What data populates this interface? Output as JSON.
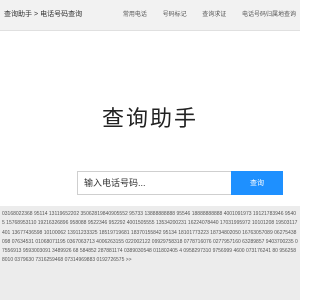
{
  "header": {
    "breadcrumb": [
      "查询助手",
      "电话号码查询"
    ],
    "breadcrumb_sep": ">",
    "nav": [
      "常用电话",
      "号码标记",
      "查询求证",
      "电话号码归属地查询"
    ]
  },
  "main": {
    "title": "查询助手",
    "search_placeholder": "输入电话号码...",
    "search_button": "查询"
  },
  "footer": {
    "numbers_text": "03168022368 95114 13119652202 35062819840905552 95733 13888888888 95546 18888888888 4001091973 19121783946 95405 15768953110 19216326896 958088 9522346 952292 4001505555 13534200231 16224078440 17031995972 10101208 19503117401 13677436598 10100062 13911233325 18519719681 18370155842 95134 18101773223 18734802050 16763057089 06275438098 07634531 01068071195 0367063713 4006263155 022002122 09929758318 0778716076 0277957160 63289857 9403700235 07556913 9593003091 3489926 68 584852 287881174 0389030548 011802405 4 0958297310 9756999 4600 073176241 80 9562588010 0379630 7316259468 07314969883 0192726575 >>"
  }
}
